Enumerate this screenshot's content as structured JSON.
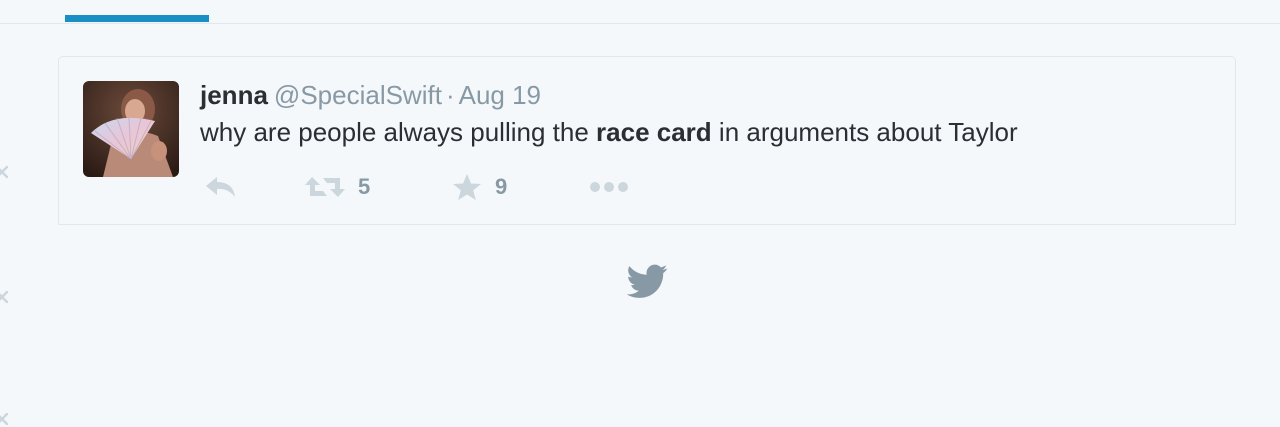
{
  "tabs": {
    "active_indicator_color": "#1a8fc4"
  },
  "tweet": {
    "fullname": "jenna",
    "username": "@SpecialSwift",
    "separator": "·",
    "time": "Aug 19",
    "text_before": "why are people always pulling the ",
    "text_bold": "race card",
    "text_after": " in arguments about Taylor",
    "avatar": "user-avatar-photo",
    "actions": {
      "reply_icon": "reply-icon",
      "retweet_icon": "retweet-icon",
      "retweet_count": "5",
      "favorite_icon": "star-icon",
      "favorite_count": "9",
      "more_icon": "more-dots-icon"
    }
  },
  "footer": {
    "icon": "twitter-bird-icon"
  },
  "colors": {
    "background": "#f5f8fa",
    "text_primary": "#292f33",
    "text_secondary": "#8899a6",
    "icon_muted": "#ccd6dd",
    "border": "#e1e8ed"
  }
}
